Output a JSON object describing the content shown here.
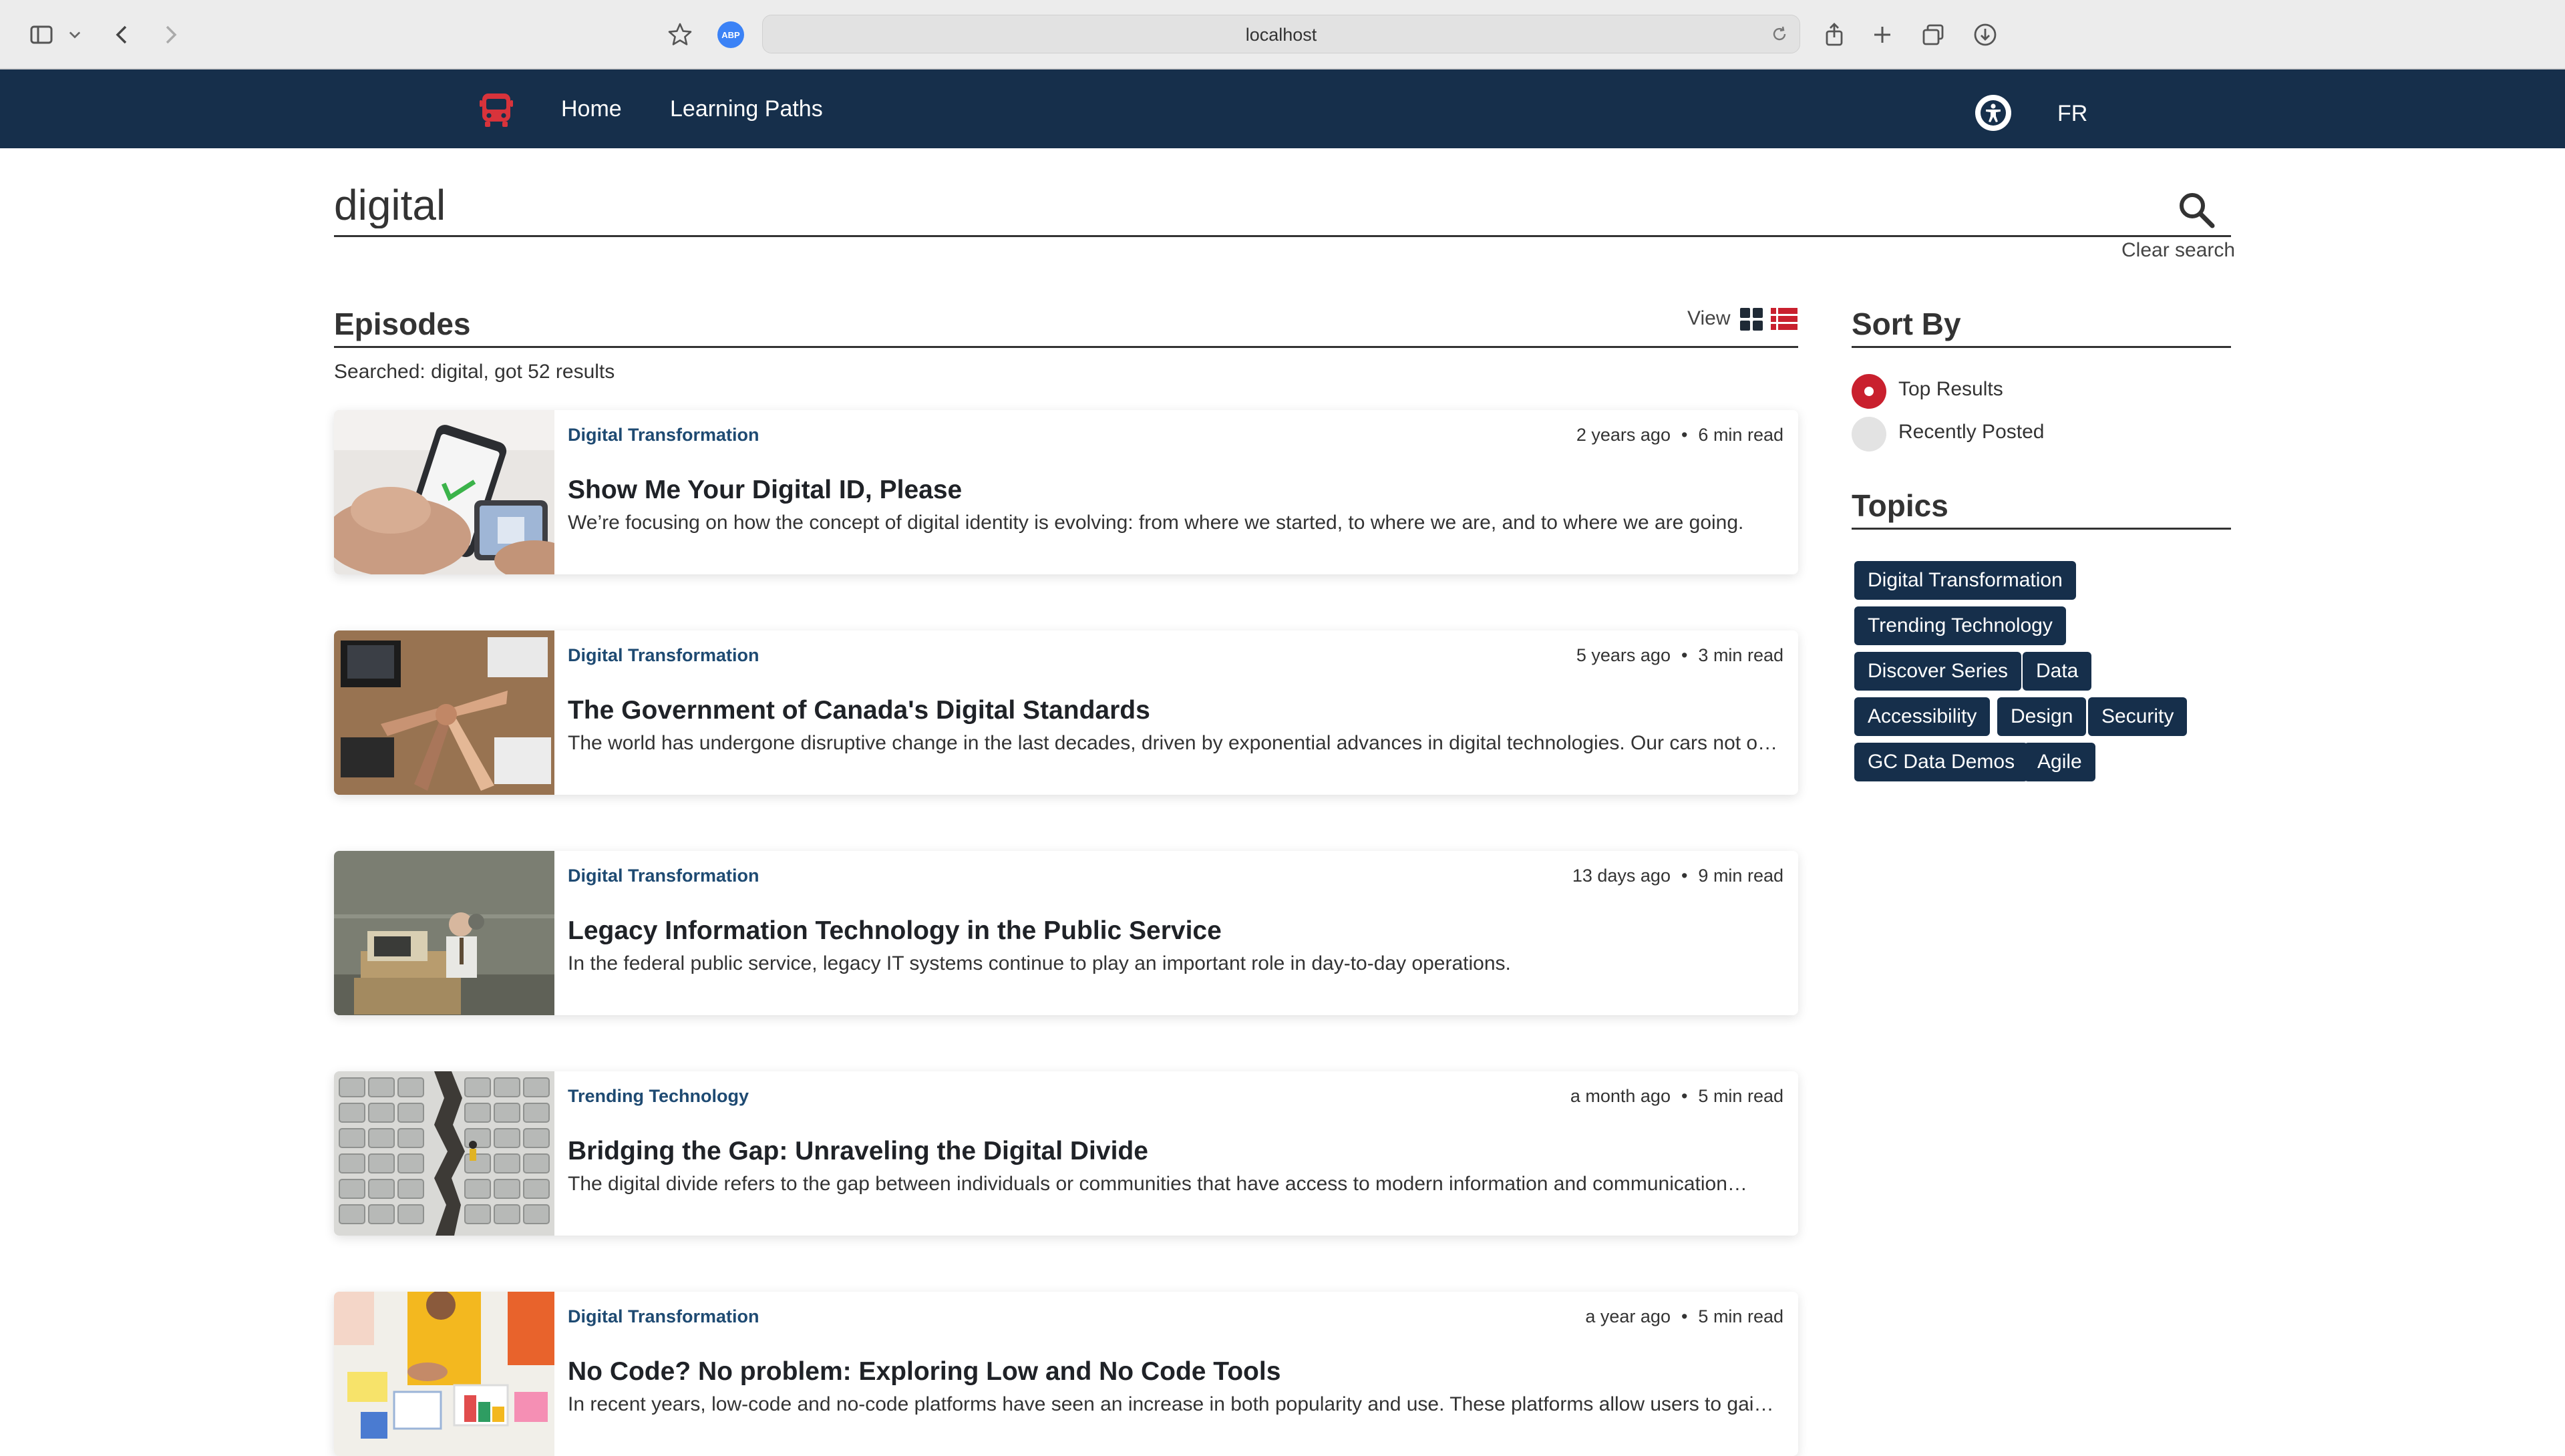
{
  "browser": {
    "url": "localhost",
    "abp_label": "ABP"
  },
  "nav": {
    "home": "Home",
    "learning_paths": "Learning Paths",
    "language_toggle": "FR"
  },
  "search": {
    "query": "digital",
    "clear_label": "Clear search"
  },
  "episodes": {
    "heading": "Episodes",
    "view_label": "View",
    "summary": "Searched: digital, got 52 results",
    "items": [
      {
        "category": "Digital Transformation",
        "age": "2 years ago",
        "read_time": "6 min read",
        "title": "Show Me Your Digital ID, Please",
        "description": "We’re focusing on how the concept of digital identity is evolving: from where we started, to where we are, and to where we are going."
      },
      {
        "category": "Digital Transformation",
        "age": "5 years ago",
        "read_time": "3 min read",
        "title": "The Government of Canada's Digital Standards",
        "description": "The world has undergone disruptive change in the last decades, driven by exponential advances in digital technologies. Our cars not o…"
      },
      {
        "category": "Digital Transformation",
        "age": "13 days ago",
        "read_time": "9 min read",
        "title": "Legacy Information Technology in the Public Service",
        "description": "In the federal public service, legacy IT systems continue to play an important role in day-to-day operations."
      },
      {
        "category": "Trending Technology",
        "age": "a month ago",
        "read_time": "5 min read",
        "title": "Bridging the Gap: Unraveling the Digital Divide",
        "description": "The digital divide refers to the gap between individuals or communities that have access to modern information and communication…"
      },
      {
        "category": "Digital Transformation",
        "age": "a year ago",
        "read_time": "5 min read",
        "title": "No Code? No problem: Exploring Low and No Code Tools",
        "description": "In recent years, low-code and no-code platforms have seen an increase in both popularity and use. These platforms allow users to gain…"
      }
    ]
  },
  "sort": {
    "heading": "Sort By",
    "options": [
      "Top Results",
      "Recently Posted"
    ],
    "selected": "Top Results"
  },
  "topics": {
    "heading": "Topics",
    "tags": [
      "Digital Transformation",
      "Trending Technology",
      "Discover Series",
      "Data",
      "Accessibility",
      "Design",
      "Security",
      "GC Data Demos",
      "Agile"
    ]
  },
  "colors": {
    "nav_bg": "#162f4b",
    "accent_red": "#c9202e",
    "category_text": "#1e4a72"
  }
}
